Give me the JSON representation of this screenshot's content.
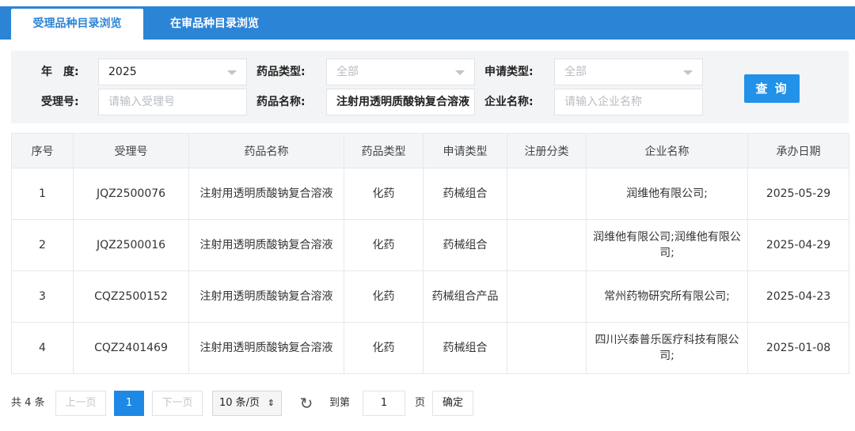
{
  "tabs": [
    {
      "label": "受理品种目录浏览",
      "active": true
    },
    {
      "label": "在审品种目录浏览",
      "active": false
    }
  ],
  "search": {
    "year_label": "年　度:",
    "year_value": "2025",
    "drug_type_label": "药品类型:",
    "drug_type_value": "全部",
    "apply_type_label": "申请类型:",
    "apply_type_value": "全部",
    "accept_no_label": "受理号:",
    "accept_no_placeholder": "请输入受理号",
    "drug_name_label": "药品名称:",
    "drug_name_value": "注射用透明质酸钠复合溶液",
    "company_label": "企业名称:",
    "company_placeholder": "请输入企业名称",
    "query_button": "查 询"
  },
  "table": {
    "headers": [
      "序号",
      "受理号",
      "药品名称",
      "药品类型",
      "申请类型",
      "注册分类",
      "企业名称",
      "承办日期"
    ],
    "rows": [
      {
        "no": "1",
        "accept_no": "JQZ2500076",
        "drug_name": "注射用透明质酸钠复合溶液",
        "drug_type": "化药",
        "apply_type": "药械组合",
        "reg_class": "",
        "company": "润维他有限公司;",
        "date": "2025-05-29"
      },
      {
        "no": "2",
        "accept_no": "JQZ2500016",
        "drug_name": "注射用透明质酸钠复合溶液",
        "drug_type": "化药",
        "apply_type": "药械组合",
        "reg_class": "",
        "company": "润维他有限公司;润维他有限公司;",
        "date": "2025-04-29"
      },
      {
        "no": "3",
        "accept_no": "CQZ2500152",
        "drug_name": "注射用透明质酸钠复合溶液",
        "drug_type": "化药",
        "apply_type": "药械组合产品",
        "reg_class": "",
        "company": "常州药物研究所有限公司;",
        "date": "2025-04-23"
      },
      {
        "no": "4",
        "accept_no": "CQZ2401469",
        "drug_name": "注射用透明质酸钠复合溶液",
        "drug_type": "化药",
        "apply_type": "药械组合",
        "reg_class": "",
        "company": "四川兴泰普乐医疗科技有限公司;",
        "date": "2025-01-08"
      }
    ]
  },
  "pagination": {
    "total": "共 4 条",
    "prev": "上一页",
    "current_page": "1",
    "next": "下一页",
    "page_size": "10 条/页",
    "refresh_icon": "refresh-icon",
    "goto_label": "到第",
    "goto_value": "1",
    "page_suffix": "页",
    "confirm": "确定"
  },
  "colors": {
    "accent": "#2c84d6",
    "button": "#2192e8",
    "current_page": "#1e88e5"
  }
}
